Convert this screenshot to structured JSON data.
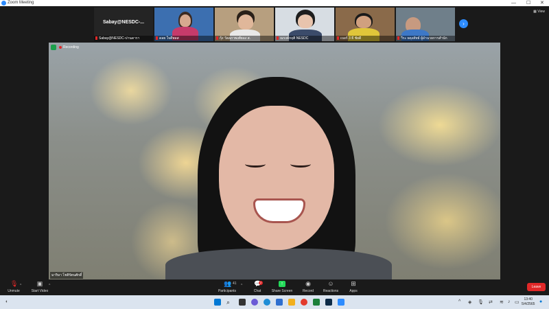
{
  "window": {
    "title": "Zoom Meeting"
  },
  "top": {
    "view_label": "View"
  },
  "participants_strip": [
    {
      "name": "Sabay@NESDC-...",
      "sublabel": "Sabay@NESDC-ปานดารา"
    },
    {
      "name": "",
      "sublabel": "ดลย ใจดีพลส"
    },
    {
      "name": "",
      "sublabel": "กุ้ง วัลลภาพงศ์ยอง ส."
    },
    {
      "name": "",
      "sublabel": "ณรงค์กฤติ NESDC"
    },
    {
      "name": "",
      "sublabel": "เบอร์ 3 ธี ชัยดี"
    },
    {
      "name": "",
      "sublabel": "วีระ ผดุงสัทธ์ ผู้อำนวยการสำนัก"
    }
  ],
  "main_video": {
    "recording_label": "Recording",
    "name": "มาริษา โชติรัตนศักดิ์"
  },
  "toolbar": {
    "unmute": "Unmute",
    "start_video": "Start Video",
    "participants": "Participants",
    "participants_count": "41",
    "chat": "Chat",
    "chat_badge": "2",
    "share_screen": "Share Screen",
    "record": "Record",
    "reactions": "Reactions",
    "apps": "Apps",
    "leave": "Leave"
  },
  "taskbar": {
    "time": "13:40",
    "date": "5/4/2565"
  },
  "colors": {
    "accent": "#2d8cff",
    "danger": "#e02828",
    "share": "#23d959"
  },
  "icons": [
    "zoom-icon",
    "mic-off-icon",
    "video-off-icon",
    "participants-icon",
    "chat-icon",
    "share-screen-icon",
    "record-icon",
    "reactions-icon",
    "apps-icon",
    "shield-icon",
    "windows-start-icon",
    "search-icon"
  ]
}
